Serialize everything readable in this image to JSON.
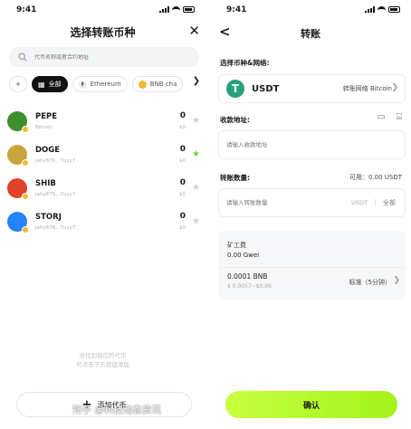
{
  "left": {
    "time": "9:41",
    "title": "选择转账币种",
    "close_icon": "close-icon",
    "search": {
      "placeholder": "代币名称或者合约地址"
    },
    "chips": [
      {
        "label": "全部"
      },
      {
        "label": "Ethereum"
      },
      {
        "label": "BNB cha"
      }
    ],
    "coins": [
      {
        "symbol": "PEPE",
        "sub": "Bitcoin",
        "balance": "0",
        "usd": "$0",
        "starred": false,
        "color": "#3e8f2e"
      },
      {
        "symbol": "DOGE",
        "sub": "jahy876...7uyy7",
        "balance": "0",
        "usd": "$0",
        "starred": true,
        "color": "#c9a43a"
      },
      {
        "symbol": "SHIB",
        "sub": "jahy876...7uyy7",
        "balance": "0",
        "usd": "$0",
        "starred": false,
        "color": "#e0422a"
      },
      {
        "symbol": "STORJ",
        "sub": "jahy876...7uyy7",
        "balance": "0",
        "usd": "$0",
        "starred": false,
        "color": "#2683ff"
      }
    ],
    "empty_line1": "没找到相应的代币",
    "empty_line2": "可点击下方按钮添加",
    "add_label": "添加代币"
  },
  "right": {
    "time": "9:41",
    "title": "转账",
    "token_section_label": "选择币种&网络:",
    "token": {
      "symbol": "USDT",
      "network": "转账网络 Bitcoin",
      "logo_letter": "T"
    },
    "address_label": "收款地址:",
    "address_placeholder": "请输入收款地址",
    "amount_label": "转账数量:",
    "available": "可用：0.00 USDT",
    "amount_placeholder": "请输入转账数量",
    "amount_unit": "USDT",
    "amount_all": "全部",
    "fee": {
      "label": "矿工费",
      "value": "0.00 Gwei",
      "amount": "0.0001 BNB",
      "sub": "$ 0.0057~$0.06",
      "mode": "标准（5分钟）"
    },
    "confirm_label": "确认",
    "watermark": "知乎 @科技动态资讯"
  }
}
